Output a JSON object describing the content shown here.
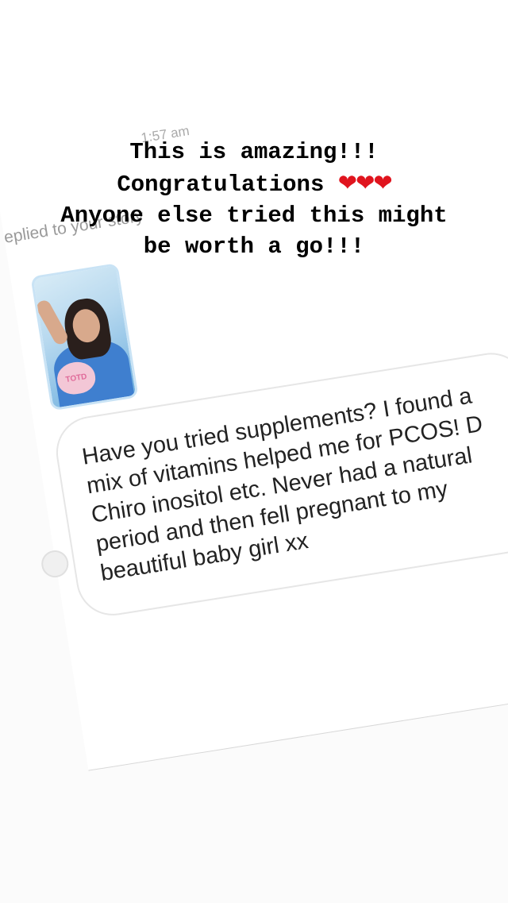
{
  "dm": {
    "timestamp": "1:57 am",
    "replied_label": "eplied to your story",
    "story_thumb_sticker": "TOTD",
    "message": "Have you tried supplements? I found a mix of vitamins helped me for PCOS! D Chiro inositol etc. Never had a natural period and then fell pregnant to my beautiful baby girl xx"
  },
  "caption": {
    "line1": "This is amazing!!!",
    "line2_text": "Congratulations ",
    "line2_hearts": "❤❤❤",
    "line3": "Anyone else tried this might",
    "line4": "be worth a go!!!"
  }
}
